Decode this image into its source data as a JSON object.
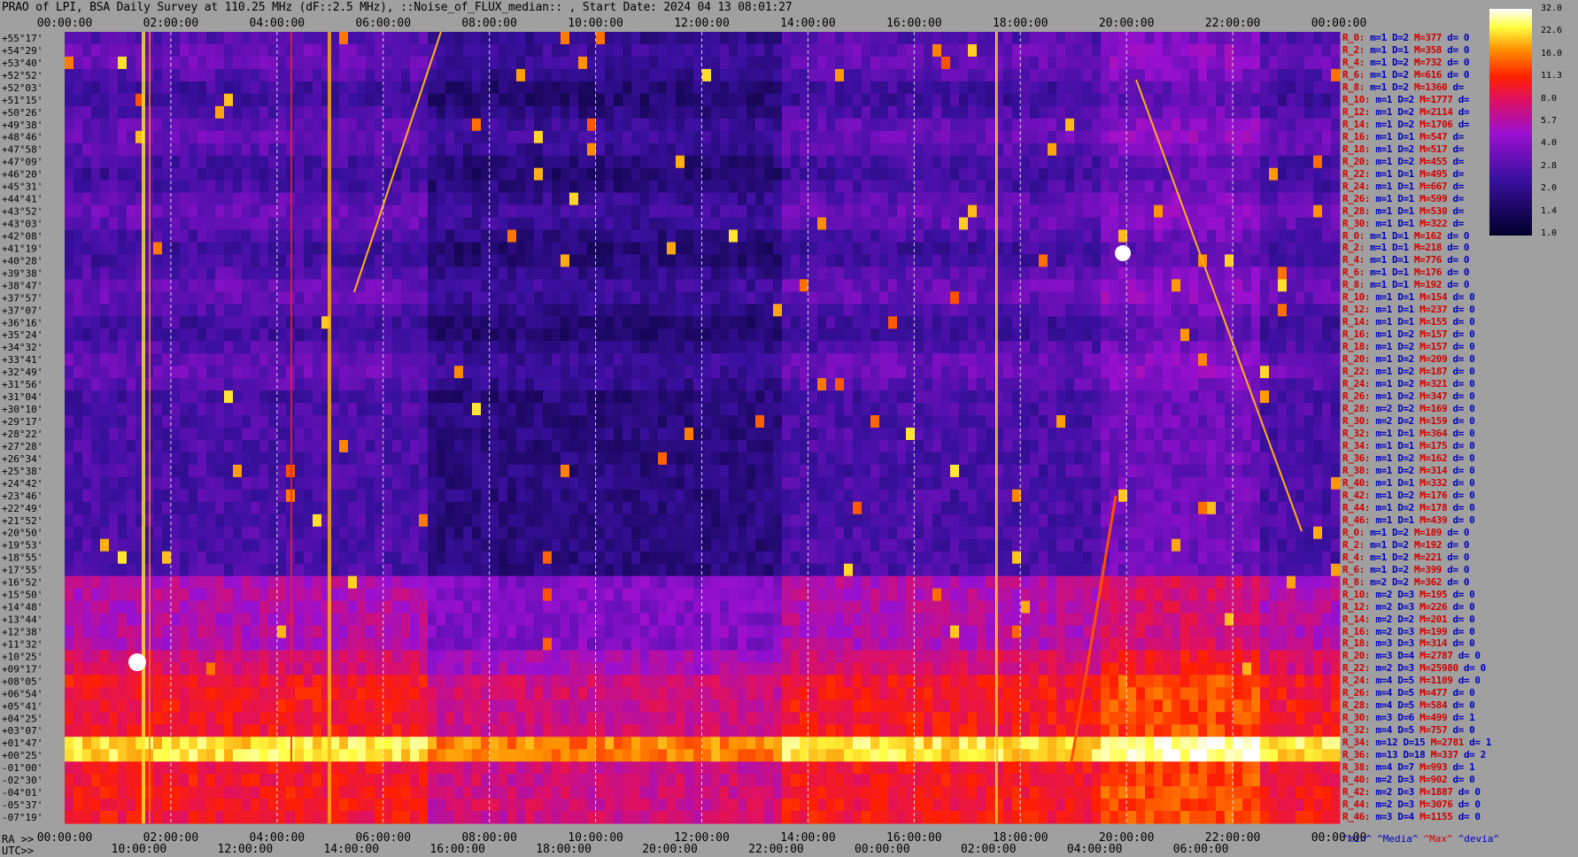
{
  "title": "PRAO of LPI, BSA Daily Survey at 110.25 MHz (dF::2.5 MHz), ::Noise_of_FLUX_median:: , Start Date: 2024 04 13 08:01:27",
  "ra_prefix": "RA >>",
  "utc_prefix": "UTC>>",
  "colors": {
    "background": "#a0a0a0",
    "bar_stop_low": "#00002a",
    "bar_stop_high": "#ffffff"
  },
  "chart_data": {
    "type": "heatmap",
    "title": "PRAO of LPI, BSA Daily Survey at 110.25 MHz (dF::2.5 MHz), ::Noise_of_FLUX_median:: , Start Date: 2024 04 13 08:01:27",
    "x_top_ticks": [
      "00:00:00",
      "02:00:00",
      "04:00:00",
      "06:00:00",
      "08:00:00",
      "10:00:00",
      "12:00:00",
      "14:00:00",
      "16:00:00",
      "18:00:00",
      "20:00:00",
      "22:00:00",
      "00:00:00"
    ],
    "x_bottom_ra_ticks": [
      "00:00:00",
      "02:00:00",
      "04:00:00",
      "06:00:00",
      "08:00:00",
      "10:00:00",
      "12:00:00",
      "14:00:00",
      "16:00:00",
      "18:00:00",
      "20:00:00",
      "22:00:00",
      "00:00:00"
    ],
    "x_bottom_utc_ticks": [
      "10:00:00",
      "12:00:00",
      "14:00:00",
      "16:00:00",
      "18:00:00",
      "20:00:00",
      "22:00:00",
      "00:00:00",
      "02:00:00",
      "04:00:00",
      "06:00:00"
    ],
    "y_declination_labels": [
      "+55°17'",
      "+54°29'",
      "+53°40'",
      "+52°52'",
      "+52°03'",
      "+51°15'",
      "+50°26'",
      "+49°38'",
      "+48°46'",
      "+47°58'",
      "+47°09'",
      "+46°20'",
      "+45°31'",
      "+44°41'",
      "+43°52'",
      "+43°03'",
      "+42°08'",
      "+41°19'",
      "+40°28'",
      "+39°38'",
      "+38°47'",
      "+37°57'",
      "+37°07'",
      "+36°16'",
      "+35°24'",
      "+34°32'",
      "+33°41'",
      "+32°49'",
      "+31°56'",
      "+31°04'",
      "+30°10'",
      "+29°17'",
      "+28°22'",
      "+27°28'",
      "+26°34'",
      "+25°38'",
      "+24°42'",
      "+23°46'",
      "+22°49'",
      "+21°52'",
      "+20°50'",
      "+19°53'",
      "+18°55'",
      "+17°55'",
      "+16°52'",
      "+15°50'",
      "+14°48'",
      "+13°44'",
      "+12°38'",
      "+11°32'",
      "+10°25'",
      "+09°17'",
      "+08°05'",
      "+06°54'",
      "+05°41'",
      "+04°25'",
      "+03°07'",
      "+01°47'",
      "+00°25'",
      "-01°00'",
      "-02°30'",
      "-04°01'",
      "-05°37'",
      "-07°19'"
    ],
    "colorbar": {
      "ticks": [
        "32.0",
        "22.6",
        "16.0",
        "11.3",
        "8.0",
        "5.7",
        "4.0",
        "2.8",
        "2.0",
        "1.4",
        "1.0"
      ],
      "scale": "log",
      "range": [
        1.0,
        32.0
      ]
    },
    "legend": [
      "^min^",
      "^Media^",
      "^Max^",
      "^devia^"
    ],
    "stats_rows": [
      [
        "R_0:",
        "m=1",
        "D=2",
        "M=377",
        "d= 0"
      ],
      [
        "R_2:",
        "m=1",
        "D=1",
        "M=358",
        "d= 0"
      ],
      [
        "R_4:",
        "m=1",
        "D=2",
        "M=732",
        "d= 0"
      ],
      [
        "R_6:",
        "m=1",
        "D=2",
        "M=616",
        "d= 0"
      ],
      [
        "R_8:",
        "m=1",
        "D=2",
        "M=1360",
        "d="
      ],
      [
        "R_10:",
        "m=1",
        "D=2",
        "M=1777",
        "d="
      ],
      [
        "R_12:",
        "m=1",
        "D=2",
        "M=2114",
        "d="
      ],
      [
        "R_14:",
        "m=1",
        "D=2",
        "M=1706",
        "d="
      ],
      [
        "R_16:",
        "m=1",
        "D=1",
        "M=547",
        "d="
      ],
      [
        "R_18:",
        "m=1",
        "D=2",
        "M=517",
        "d="
      ],
      [
        "R_20:",
        "m=1",
        "D=2",
        "M=455",
        "d="
      ],
      [
        "R_22:",
        "m=1",
        "D=1",
        "M=495",
        "d="
      ],
      [
        "R_24:",
        "m=1",
        "D=1",
        "M=667",
        "d="
      ],
      [
        "R_26:",
        "m=1",
        "D=1",
        "M=599",
        "d="
      ],
      [
        "R_28:",
        "m=1",
        "D=1",
        "M=530",
        "d="
      ],
      [
        "R_30:",
        "m=1",
        "D=1",
        "M=322",
        "d="
      ],
      [
        "R_0:",
        "m=1",
        "D=1",
        "M=162",
        "d= 0"
      ],
      [
        "R_2:",
        "m=1",
        "D=1",
        "M=218",
        "d= 0"
      ],
      [
        "R_4:",
        "m=1",
        "D=1",
        "M=776",
        "d= 0"
      ],
      [
        "R_6:",
        "m=1",
        "D=1",
        "M=176",
        "d= 0"
      ],
      [
        "R_8:",
        "m=1",
        "D=1",
        "M=192",
        "d= 0"
      ],
      [
        "R_10:",
        "m=1",
        "D=1",
        "M=154",
        "d= 0"
      ],
      [
        "R_12:",
        "m=1",
        "D=1",
        "M=237",
        "d= 0"
      ],
      [
        "R_14:",
        "m=1",
        "D=1",
        "M=155",
        "d= 0"
      ],
      [
        "R_16:",
        "m=1",
        "D=2",
        "M=157",
        "d= 0"
      ],
      [
        "R_18:",
        "m=1",
        "D=2",
        "M=157",
        "d= 0"
      ],
      [
        "R_20:",
        "m=1",
        "D=2",
        "M=209",
        "d= 0"
      ],
      [
        "R_22:",
        "m=1",
        "D=2",
        "M=187",
        "d= 0"
      ],
      [
        "R_24:",
        "m=1",
        "D=2",
        "M=321",
        "d= 0"
      ],
      [
        "R_26:",
        "m=1",
        "D=2",
        "M=347",
        "d= 0"
      ],
      [
        "R_28:",
        "m=2",
        "D=2",
        "M=169",
        "d= 0"
      ],
      [
        "R_30:",
        "m=2",
        "D=2",
        "M=159",
        "d= 0"
      ],
      [
        "R_32:",
        "m=1",
        "D=1",
        "M=364",
        "d= 0"
      ],
      [
        "R_34:",
        "m=1",
        "D=1",
        "M=175",
        "d= 0"
      ],
      [
        "R_36:",
        "m=1",
        "D=2",
        "M=162",
        "d= 0"
      ],
      [
        "R_38:",
        "m=1",
        "D=2",
        "M=314",
        "d= 0"
      ],
      [
        "R_40:",
        "m=1",
        "D=1",
        "M=332",
        "d= 0"
      ],
      [
        "R_42:",
        "m=1",
        "D=2",
        "M=176",
        "d= 0"
      ],
      [
        "R_44:",
        "m=1",
        "D=2",
        "M=178",
        "d= 0"
      ],
      [
        "R_46:",
        "m=1",
        "D=1",
        "M=439",
        "d= 0"
      ],
      [
        "R_0:",
        "m=1",
        "D=2",
        "M=189",
        "d= 0"
      ],
      [
        "R_2:",
        "m=1",
        "D=2",
        "M=192",
        "d= 0"
      ],
      [
        "R_4:",
        "m=1",
        "D=2",
        "M=221",
        "d= 0"
      ],
      [
        "R_6:",
        "m=1",
        "D=2",
        "M=399",
        "d= 0"
      ],
      [
        "R_8:",
        "m=2",
        "D=2",
        "M=362",
        "d= 0"
      ],
      [
        "R_10:",
        "m=2",
        "D=3",
        "M=195",
        "d= 0"
      ],
      [
        "R_12:",
        "m=2",
        "D=3",
        "M=226",
        "d= 0"
      ],
      [
        "R_14:",
        "m=2",
        "D=2",
        "M=201",
        "d= 0"
      ],
      [
        "R_16:",
        "m=2",
        "D=3",
        "M=199",
        "d= 0"
      ],
      [
        "R_18:",
        "m=3",
        "D=3",
        "M=314",
        "d= 0"
      ],
      [
        "R_20:",
        "m=3",
        "D=4",
        "M=2787",
        "d= 0"
      ],
      [
        "R_22:",
        "m=2",
        "D=3",
        "M=25980",
        "d= 0"
      ],
      [
        "R_24:",
        "m=4",
        "D=5",
        "M=1109",
        "d= 0"
      ],
      [
        "R_26:",
        "m=4",
        "D=5",
        "M=477",
        "d= 0"
      ],
      [
        "R_28:",
        "m=4",
        "D=5",
        "M=584",
        "d= 0"
      ],
      [
        "R_30:",
        "m=3",
        "D=6",
        "M=499",
        "d= 1"
      ],
      [
        "R_32:",
        "m=4",
        "D=5",
        "M=757",
        "d= 0"
      ],
      [
        "R_34:",
        "m=12",
        "D=15",
        "M=2781",
        "d= 1"
      ],
      [
        "R_36:",
        "m=13",
        "D=18",
        "M=337",
        "d= 2"
      ],
      [
        "R_38:",
        "m=4",
        "D=7",
        "M=993",
        "d= 1"
      ],
      [
        "R_40:",
        "m=2",
        "D=3",
        "M=902",
        "d= 0"
      ],
      [
        "R_42:",
        "m=2",
        "D=3",
        "M=1887",
        "d= 0"
      ],
      [
        "R_44:",
        "m=2",
        "D=3",
        "M=3076",
        "d= 0"
      ],
      [
        "R_46:",
        "m=3",
        "D=4",
        "M=1155",
        "d= 0"
      ]
    ]
  }
}
